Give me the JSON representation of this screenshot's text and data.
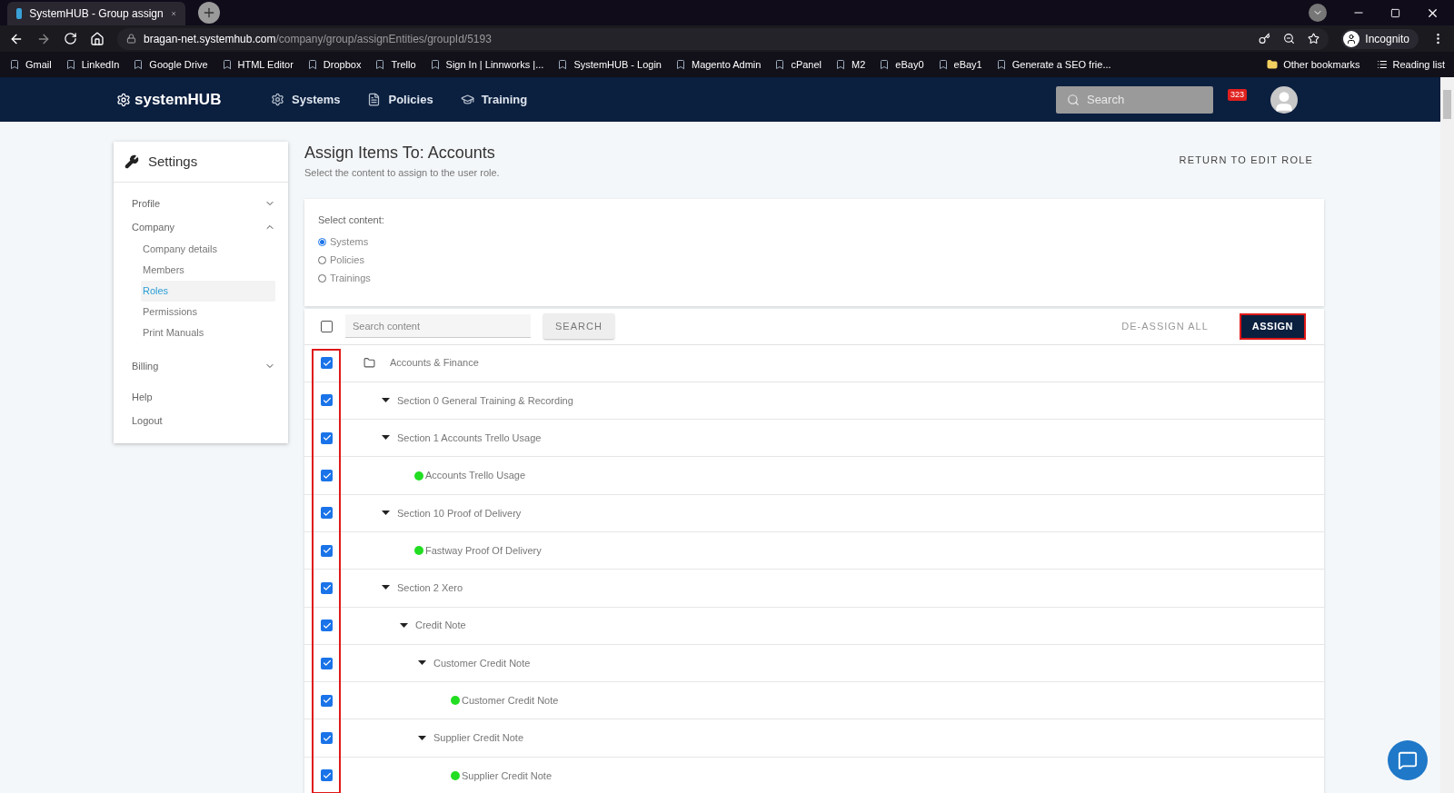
{
  "browser": {
    "tab_title": "SystemHUB - Group assign",
    "url_host": "bragan-net.systemhub.com",
    "url_path": "/company/group/assignEntities/groupId/5193",
    "profile": "Incognito",
    "bookmarks": [
      "Gmail",
      "LinkedIn",
      "Google Drive",
      "HTML Editor",
      "Dropbox",
      "Trello",
      "Sign In | Linnworks |...",
      "SystemHUB - Login",
      "Magento Admin",
      "cPanel",
      "M2",
      "eBay0",
      "eBay1",
      "Generate a SEO frie..."
    ],
    "other_bookmarks": "Other bookmarks",
    "reading_list": "Reading list"
  },
  "nav": {
    "logo": "systemHUB",
    "items": [
      "Systems",
      "Policies",
      "Training"
    ],
    "search_placeholder": "Search",
    "notification_count": "323"
  },
  "sidebar": {
    "title": "Settings",
    "items": [
      {
        "label": "Profile",
        "expanded": false,
        "selected": false
      },
      {
        "label": "Company",
        "expanded": true,
        "selected": false,
        "children": [
          {
            "label": "Company details",
            "selected": false
          },
          {
            "label": "Members",
            "selected": false
          },
          {
            "label": "Roles",
            "selected": true
          },
          {
            "label": "Permissions",
            "selected": false
          },
          {
            "label": "Print Manuals",
            "selected": false
          }
        ]
      },
      {
        "label": "Billing",
        "expanded": false,
        "selected": false
      },
      {
        "label": "Help",
        "selected": false
      },
      {
        "label": "Logout",
        "selected": false
      }
    ]
  },
  "page": {
    "title": "Assign Items To: Accounts",
    "subtitle": "Select the content to assign to the user role.",
    "return_link": "RETURN TO EDIT ROLE"
  },
  "select_content": {
    "label": "Select content:",
    "options": [
      {
        "label": "Systems",
        "selected": true
      },
      {
        "label": "Policies",
        "selected": false
      },
      {
        "label": "Trainings",
        "selected": false
      }
    ]
  },
  "toolbar": {
    "select_all_checked": false,
    "search_placeholder": "Search content",
    "search_button": "SEARCH",
    "deassign_button": "DE-ASSIGN ALL",
    "assign_button": "ASSIGN",
    "assign_highlighted": true
  },
  "tree": {
    "checkboxes_highlighted": true,
    "nodes": [
      {
        "kind": "folder",
        "label": "Accounts & Finance",
        "checked": true,
        "children": [
          {
            "kind": "section",
            "label": "Section 0 General Training & Recording",
            "checked": true,
            "expanded": true
          },
          {
            "kind": "section",
            "label": "Section 1 Accounts Trello Usage",
            "checked": true,
            "expanded": true,
            "children": [
              {
                "kind": "system",
                "label": "Accounts Trello Usage",
                "checked": true,
                "color": "#22dd22"
              }
            ]
          },
          {
            "kind": "section",
            "label": "Section 10 Proof of Delivery",
            "checked": true,
            "expanded": true,
            "children": [
              {
                "kind": "system",
                "label": "Fastway Proof Of Delivery",
                "checked": true,
                "color": "#22dd22"
              }
            ]
          },
          {
            "kind": "section",
            "label": "Section 2 Xero",
            "checked": true,
            "expanded": true,
            "children": [
              {
                "kind": "section",
                "label": "Credit Note",
                "checked": true,
                "expanded": true,
                "children": [
                  {
                    "kind": "section",
                    "label": "Customer Credit Note",
                    "checked": true,
                    "expanded": true,
                    "children": [
                      {
                        "kind": "system",
                        "label": "Customer Credit Note",
                        "checked": true,
                        "color": "#22dd22"
                      }
                    ]
                  },
                  {
                    "kind": "section",
                    "label": "Supplier Credit Note",
                    "checked": true,
                    "expanded": true,
                    "children": [
                      {
                        "kind": "system",
                        "label": "Supplier Credit Note",
                        "checked": true,
                        "color": "#22dd22"
                      }
                    ]
                  }
                ]
              }
            ]
          }
        ]
      }
    ]
  }
}
